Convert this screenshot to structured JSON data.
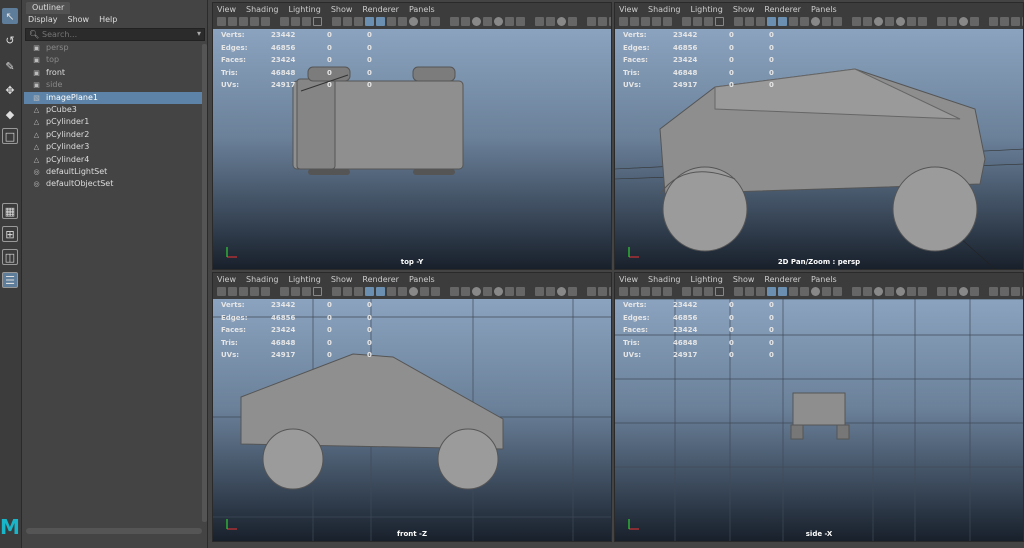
{
  "outliner": {
    "tab_label": "Outliner",
    "menu": [
      "Display",
      "Show",
      "Help"
    ],
    "search_placeholder": "Search...",
    "items": [
      {
        "label": "persp",
        "icon": "camera-icon",
        "dim": true
      },
      {
        "label": "top",
        "icon": "camera-icon",
        "dim": true
      },
      {
        "label": "front",
        "icon": "camera-icon",
        "dim": false
      },
      {
        "label": "side",
        "icon": "camera-icon",
        "dim": true
      },
      {
        "label": "imagePlane1",
        "icon": "image-plane-icon",
        "selected": true
      },
      {
        "label": "pCube3",
        "icon": "mesh-icon"
      },
      {
        "label": "pCylinder1",
        "icon": "mesh-icon"
      },
      {
        "label": "pCylinder2",
        "icon": "mesh-icon"
      },
      {
        "label": "pCylinder3",
        "icon": "mesh-icon"
      },
      {
        "label": "pCylinder4",
        "icon": "mesh-icon"
      },
      {
        "label": "defaultLightSet",
        "icon": "set-icon"
      },
      {
        "label": "defaultObjectSet",
        "icon": "set-icon"
      }
    ]
  },
  "panel_menu": [
    "View",
    "Shading",
    "Lighting",
    "Show",
    "Renderer",
    "Panels"
  ],
  "hud": {
    "rows": [
      {
        "label": "Verts:",
        "v1": "23442",
        "v2": "0",
        "v3": "0"
      },
      {
        "label": "Edges:",
        "v1": "46856",
        "v2": "0",
        "v3": "0"
      },
      {
        "label": "Faces:",
        "v1": "23424",
        "v2": "0",
        "v3": "0"
      },
      {
        "label": "Tris:",
        "v1": "46848",
        "v2": "0",
        "v3": "0"
      },
      {
        "label": "UVs:",
        "v1": "24917",
        "v2": "0",
        "v3": "0"
      }
    ]
  },
  "viewports": {
    "top": {
      "camera_label": "top -Y"
    },
    "persp": {
      "camera_label": "2D Pan/Zoom : persp"
    },
    "front": {
      "camera_label": "front -Z"
    },
    "side": {
      "camera_label": "side -X"
    }
  },
  "toolbox": {
    "tools": [
      "select-tool-icon",
      "lasso-tool-icon",
      "paint-tool-icon",
      "move-tool-icon",
      "rotate-tool-icon",
      "scale-tool-icon"
    ],
    "logo": "M"
  },
  "colors": {
    "selection": "#5d84a8",
    "logo": "#19b5c8"
  }
}
